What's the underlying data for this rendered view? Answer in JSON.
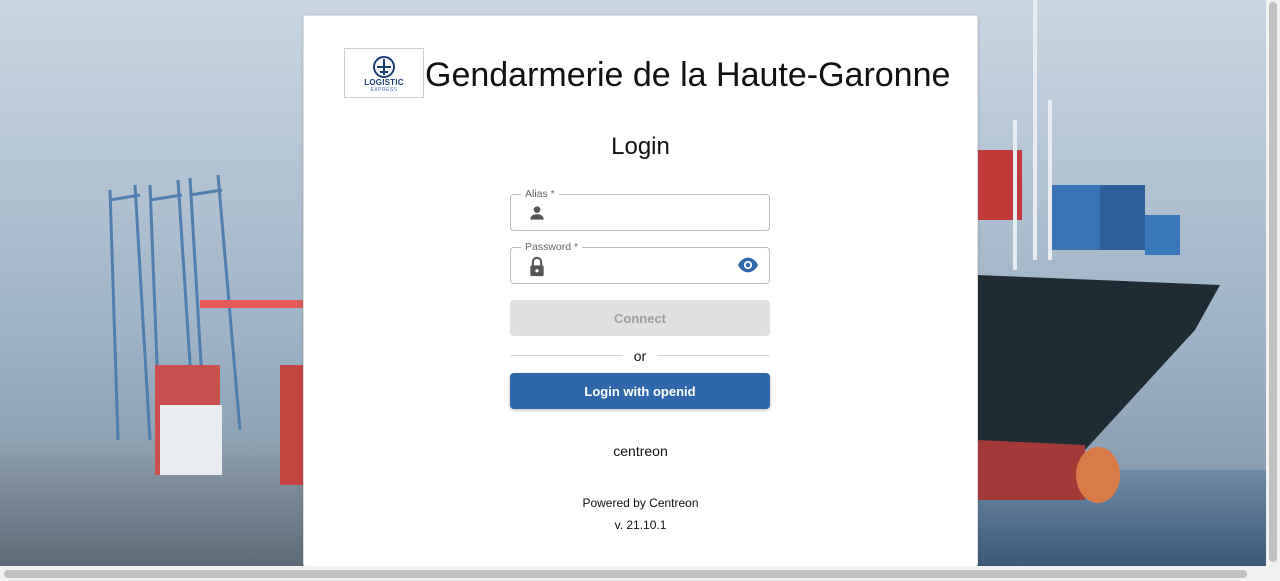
{
  "header": {
    "title": "Gendarmerie de la Haute-Garonne",
    "logo": {
      "word": "LOGISTIC",
      "subword": "EXPRESS"
    }
  },
  "login": {
    "heading": "Login",
    "alias": {
      "label": "Alias *",
      "value": "",
      "icon": "person-icon"
    },
    "password": {
      "label": "Password *",
      "value": "",
      "icon": "lock-icon",
      "toggle_icon": "eye-icon"
    },
    "connect_label": "Connect",
    "separator": "or",
    "openid_label": "Login with openid"
  },
  "footer": {
    "platform_name": "centreon",
    "powered_by": "Powered by Centreon",
    "version": "v. 21.10.1"
  },
  "colors": {
    "primary": "#2e68aa",
    "disabled_button": "#e0e0e0",
    "disabled_text": "#9e9e9e"
  }
}
